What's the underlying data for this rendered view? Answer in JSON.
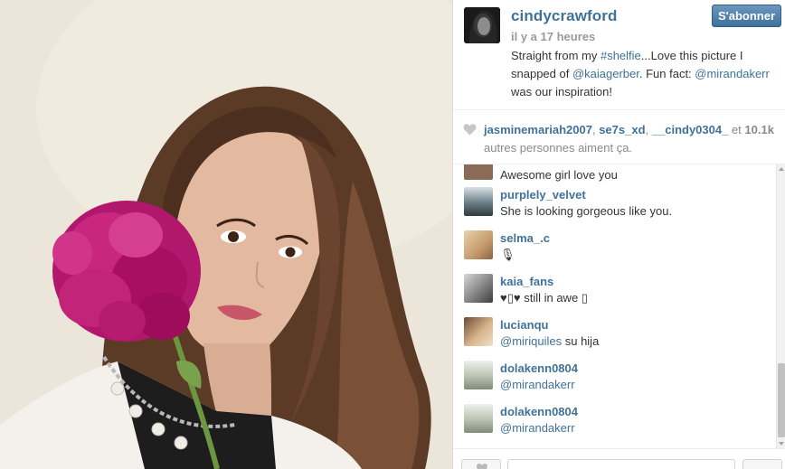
{
  "post": {
    "owner": "cindycrawford",
    "follow_label": "S'abonner",
    "time": "il y a 17 heures",
    "caption": {
      "before_hashtag": "Straight from my ",
      "hashtag": "#shelfie",
      "after_hashtag": "...Love this picture I snapped of ",
      "mention_1": "@kaiagerber",
      "middle": ". Fun fact: ",
      "mention_2": "@mirandakerr",
      "end": " was our inspiration!"
    }
  },
  "likes": {
    "users": [
      "jasminemariah2007",
      "se7s_xd",
      "__cindy0304_"
    ],
    "separator": ", ",
    "connector": " et ",
    "count": "10.1k",
    "suffix": " autres personnes aiment ça."
  },
  "comments": [
    {
      "user": "",
      "text": "Awesome girl love you",
      "mention": ""
    },
    {
      "user": "purplely_velvet",
      "text": "She is looking gorgeous like you.",
      "mention": ""
    },
    {
      "user": "selma_.c",
      "text": "🎙",
      "mention": ""
    },
    {
      "user": "kaia_fans",
      "text": "♥▯♥ still in awe ▯",
      "mention": ""
    },
    {
      "user": "lucianqu",
      "text": " su hija",
      "mention": "@miriquiles"
    },
    {
      "user": "dolakenn0804",
      "text": "",
      "mention": "@mirandakerr"
    },
    {
      "user": "dolakenn0804",
      "text": "",
      "mention": "@mirandakerr"
    }
  ],
  "colors": {
    "link": "#3f729b",
    "follow_button": "#3f729b",
    "muted": "#9a9a9a"
  },
  "icons": {
    "like": "heart-icon"
  }
}
